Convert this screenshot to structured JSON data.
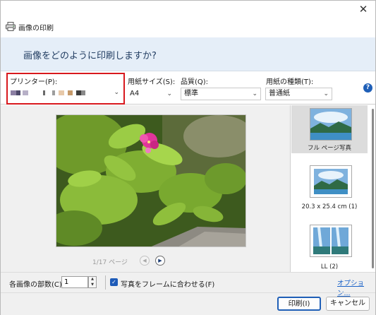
{
  "window": {
    "title": "画像の印刷",
    "close_symbol": "✕"
  },
  "header": {
    "question": "画像をどのように印刷しますか?"
  },
  "options": {
    "printer": {
      "label": "プリンター(P):",
      "value_obscured": true
    },
    "paper_size": {
      "label": "用紙サイズ(S):",
      "value": "A4"
    },
    "quality": {
      "label": "品質(Q):",
      "value": "標準"
    },
    "paper_type": {
      "label": "用紙の種類(T):",
      "value": "普通紙"
    },
    "help_symbol": "?"
  },
  "preview": {
    "page_indicator": "1/17 ページ",
    "prev_symbol": "◀",
    "next_symbol": "▶"
  },
  "layouts": [
    {
      "caption": "フル ページ写真",
      "selected": true
    },
    {
      "caption": "20.3 x 25.4 cm (1)",
      "selected": false
    },
    {
      "caption": "LL (2)",
      "selected": false
    }
  ],
  "footer": {
    "copies_label": "各画像の部数(C):",
    "copies_value": "1",
    "fit_to_frame_label": "写真をフレームに合わせる(F)",
    "fit_to_frame_checked": true,
    "options_link": "オプション...",
    "print_button": "印刷(I)",
    "cancel_button": "キャンセル"
  },
  "icons": {
    "app": "printer-icon",
    "help": "help-icon",
    "check": "✓",
    "chevron": "⌵"
  }
}
